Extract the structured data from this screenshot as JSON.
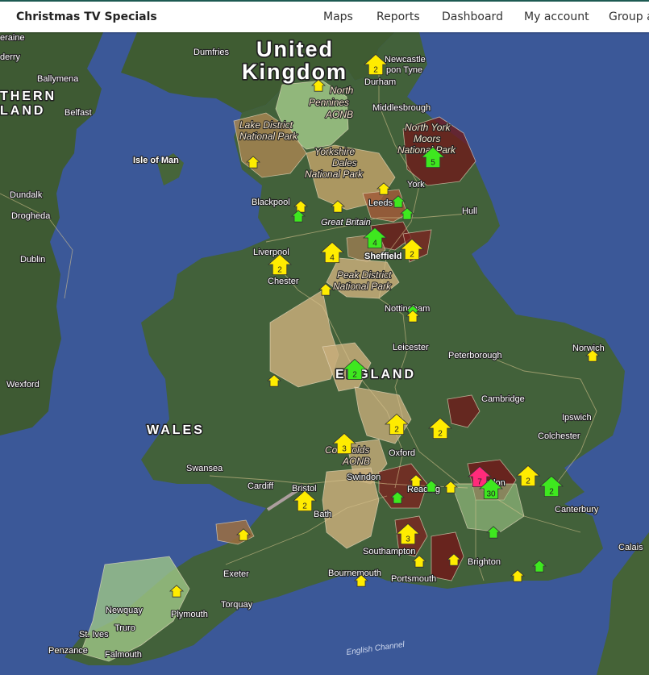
{
  "app_title": "Christmas TV Specials",
  "nav": [
    "Maps",
    "Reports",
    "Dashboard",
    "My account",
    "Group a"
  ],
  "colors": {
    "yellow": "#ffec00",
    "green": "#3ee81f",
    "pink": "#ff2b7a",
    "region_tan": "#c7ad7a",
    "region_brown": "#9e6e3f",
    "region_dark": "#6e1a1a",
    "region_green": "#9fc787"
  },
  "map_labels": [
    {
      "text": "United",
      "kind": "big"
    },
    {
      "text": "Kingdom",
      "kind": "big"
    },
    {
      "text": "ENGLAND",
      "kind": "mid"
    },
    {
      "text": "WALES",
      "kind": "mid"
    },
    {
      "text": "THERN",
      "kind": "mid"
    },
    {
      "text": "LAND",
      "kind": "mid"
    },
    {
      "text": "Isle of Man",
      "kind": "bold"
    },
    {
      "text": "Newcastle"
    },
    {
      "text": "pon Tyne"
    },
    {
      "text": "Durham"
    },
    {
      "text": "Middlesbrough"
    },
    {
      "text": "North York"
    },
    {
      "text": "Moors"
    },
    {
      "text": "National Park"
    },
    {
      "text": "North"
    },
    {
      "text": "Pennines"
    },
    {
      "text": "AONB"
    },
    {
      "text": "Lake District"
    },
    {
      "text": "National Park"
    },
    {
      "text": "Yorkshire"
    },
    {
      "text": "Dales"
    },
    {
      "text": "National Park"
    },
    {
      "text": "York"
    },
    {
      "text": "Leeds"
    },
    {
      "text": "Hull"
    },
    {
      "text": "Blackpool"
    },
    {
      "text": "Great Britain"
    },
    {
      "text": "Liverpool"
    },
    {
      "text": "Sheffield"
    },
    {
      "text": "Chester"
    },
    {
      "text": "Peak District"
    },
    {
      "text": "National Park"
    },
    {
      "text": "Nottingham"
    },
    {
      "text": "Leicester"
    },
    {
      "text": "Peterborough"
    },
    {
      "text": "Norwich"
    },
    {
      "text": "Cambridge"
    },
    {
      "text": "Ipswich"
    },
    {
      "text": "Colchester"
    },
    {
      "text": "Oxford"
    },
    {
      "text": "Cotswolds"
    },
    {
      "text": "AONB"
    },
    {
      "text": "Swansea"
    },
    {
      "text": "Cardiff"
    },
    {
      "text": "Bristol"
    },
    {
      "text": "Bath"
    },
    {
      "text": "Swindon"
    },
    {
      "text": "Reading"
    },
    {
      "text": "London"
    },
    {
      "text": "Canterbury"
    },
    {
      "text": "Southampton"
    },
    {
      "text": "Brighton"
    },
    {
      "text": "Bournemouth"
    },
    {
      "text": "Portsmouth"
    },
    {
      "text": "Exeter"
    },
    {
      "text": "Torquay"
    },
    {
      "text": "Plymouth"
    },
    {
      "text": "Newquay"
    },
    {
      "text": "Truro"
    },
    {
      "text": "St. Ives"
    },
    {
      "text": "Penzance"
    },
    {
      "text": "Falmouth"
    },
    {
      "text": "Calais"
    },
    {
      "text": "Dumfries"
    },
    {
      "text": "Belfast"
    },
    {
      "text": "Ballymena"
    },
    {
      "text": "Dundalk"
    },
    {
      "text": "Drogheda"
    },
    {
      "text": "Dublin"
    },
    {
      "text": "Wexford"
    },
    {
      "text": "eraine"
    },
    {
      "text": "derry"
    },
    {
      "text": "English Channel",
      "kind": "sea"
    }
  ],
  "markers": [
    {
      "color": "yellow",
      "count": "2"
    },
    {
      "color": "yellow",
      "count": ""
    },
    {
      "color": "green",
      "count": "5"
    },
    {
      "color": "yellow",
      "count": ""
    },
    {
      "color": "yellow",
      "count": ""
    },
    {
      "color": "green",
      "count": ""
    },
    {
      "color": "yellow",
      "count": ""
    },
    {
      "color": "green",
      "count": ""
    },
    {
      "color": "yellow",
      "count": ""
    },
    {
      "color": "green",
      "count": ""
    },
    {
      "color": "green",
      "count": "4"
    },
    {
      "color": "yellow",
      "count": "4"
    },
    {
      "color": "yellow",
      "count": "2"
    },
    {
      "color": "yellow",
      "count": "2"
    },
    {
      "color": "yellow",
      "count": ""
    },
    {
      "color": "green",
      "count": ""
    },
    {
      "color": "yellow",
      "count": ""
    },
    {
      "color": "green",
      "count": "2"
    },
    {
      "color": "yellow",
      "count": ""
    },
    {
      "color": "yellow",
      "count": ""
    },
    {
      "color": "yellow",
      "count": "2"
    },
    {
      "color": "yellow",
      "count": "2"
    },
    {
      "color": "yellow",
      "count": "3"
    },
    {
      "color": "pink",
      "count": "7"
    },
    {
      "color": "green",
      "count": "30"
    },
    {
      "color": "yellow",
      "count": "2"
    },
    {
      "color": "green",
      "count": "2"
    },
    {
      "color": "yellow",
      "count": "2"
    },
    {
      "color": "yellow",
      "count": ""
    },
    {
      "color": "green",
      "count": ""
    },
    {
      "color": "green",
      "count": ""
    },
    {
      "color": "yellow",
      "count": ""
    },
    {
      "color": "yellow",
      "count": ""
    },
    {
      "color": "green",
      "count": ""
    },
    {
      "color": "yellow",
      "count": "3"
    },
    {
      "color": "yellow",
      "count": ""
    },
    {
      "color": "yellow",
      "count": ""
    },
    {
      "color": "yellow",
      "count": ""
    },
    {
      "color": "green",
      "count": ""
    },
    {
      "color": "yellow",
      "count": ""
    },
    {
      "color": "yellow",
      "count": ""
    }
  ]
}
